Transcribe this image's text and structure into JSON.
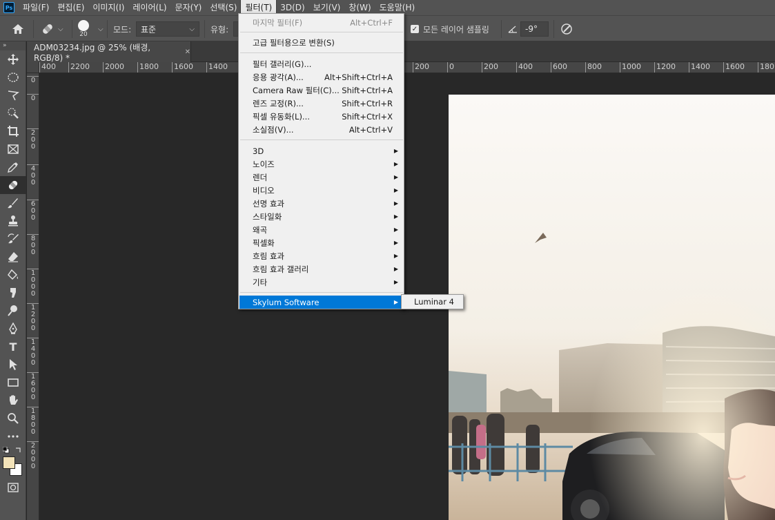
{
  "app": {
    "logo": "Ps"
  },
  "menubar": {
    "items": [
      "파일(F)",
      "편집(E)",
      "이미지(I)",
      "레이어(L)",
      "문자(Y)",
      "선택(S)",
      "필터(T)",
      "3D(D)",
      "보기(V)",
      "창(W)",
      "도움말(H)"
    ],
    "active_index": 6
  },
  "options": {
    "brush_size": "20",
    "mode_label": "모드:",
    "mode_value": "표준",
    "type_label": "유형:",
    "sample_all_layers_label": "모든 레이어 샘플링",
    "sample_all_layers_checked": true,
    "angle_value": "-9°"
  },
  "document": {
    "tab_title": "ADM03234.jpg @ 25% (배경, RGB/8) *"
  },
  "ruler": {
    "h_ticks_left": [
      "400",
      "2200",
      "2000",
      "1800",
      "1600",
      "1400"
    ],
    "h_ticks_right": [
      "200",
      "0",
      "200",
      "400",
      "600",
      "800",
      "1000",
      "1200",
      "1400",
      "1600",
      "180"
    ],
    "v_ticks": [
      "0",
      "0",
      "2\n0\n0",
      "4\n0\n0",
      "6\n0\n0",
      "8\n0\n0",
      "1\n0\n0\n0",
      "1\n2\n0\n0",
      "1\n4\n0\n0",
      "1\n6\n0\n0",
      "1\n8\n0\n0",
      "2\n0\n0\n0"
    ]
  },
  "filter_menu": {
    "groups": [
      [
        {
          "label": "마지막 필터(F)",
          "shortcut": "Alt+Ctrl+F",
          "disabled": true
        }
      ],
      [
        {
          "label": "고급 필터용으로 변환(S)",
          "shortcut": ""
        }
      ],
      [
        {
          "label": "필터 갤러리(G)...",
          "shortcut": ""
        },
        {
          "label": "응용 광각(A)...",
          "shortcut": "Alt+Shift+Ctrl+A"
        },
        {
          "label": "Camera Raw 필터(C)...",
          "shortcut": "Shift+Ctrl+A"
        },
        {
          "label": "렌즈 교정(R)...",
          "shortcut": "Shift+Ctrl+R"
        },
        {
          "label": "픽셀 유동화(L)...",
          "shortcut": "Shift+Ctrl+X"
        },
        {
          "label": "소실점(V)...",
          "shortcut": "Alt+Ctrl+V"
        }
      ],
      [
        {
          "label": "3D",
          "submenu": true
        },
        {
          "label": "노이즈",
          "submenu": true
        },
        {
          "label": "렌더",
          "submenu": true
        },
        {
          "label": "비디오",
          "submenu": true
        },
        {
          "label": "선명 효과",
          "submenu": true
        },
        {
          "label": "스타일화",
          "submenu": true
        },
        {
          "label": "왜곡",
          "submenu": true
        },
        {
          "label": "픽셀화",
          "submenu": true
        },
        {
          "label": "흐림 효과",
          "submenu": true
        },
        {
          "label": "흐림 효과 갤러리",
          "submenu": true
        },
        {
          "label": "기타",
          "submenu": true
        }
      ],
      [
        {
          "label": "Skylum Software",
          "submenu": true,
          "highlighted": true
        }
      ]
    ]
  },
  "submenu": {
    "items": [
      "Luminar 4"
    ]
  },
  "colors": {
    "foreground": "#f3e3b9",
    "background": "#ffffff",
    "highlight": "#0078d7"
  }
}
